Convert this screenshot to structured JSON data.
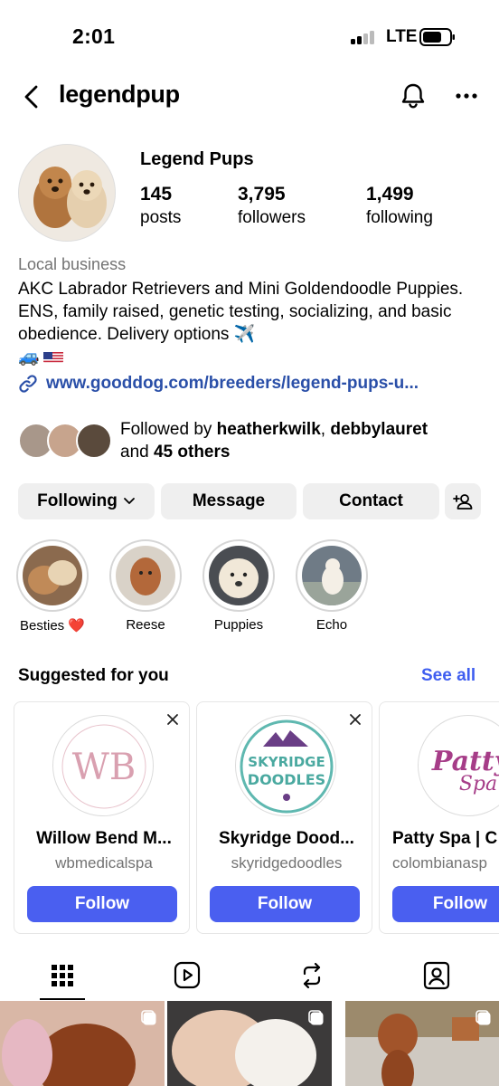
{
  "status": {
    "time": "2:01",
    "network": "LTE"
  },
  "header": {
    "username": "legendpup"
  },
  "profile": {
    "display_name": "Legend Pups",
    "stats": [
      {
        "value": "145",
        "label": "posts"
      },
      {
        "value": "3,795",
        "label": "followers"
      },
      {
        "value": "1,499",
        "label": "following"
      }
    ],
    "category": "Local business",
    "bio": "AKC Labrador Retrievers and Mini Goldendoodle Puppies. ENS, family raised, genetic testing, socializing, and basic obedience. Delivery options ✈️",
    "bio_emoji_line": "🚙",
    "link": "www.gooddog.com/breeders/legend-pups-u...",
    "followed_by": {
      "prefix": "Followed by ",
      "user1": "heatherkwilk",
      "separator": ", ",
      "user2": "debbylauret",
      "and": "and ",
      "others": "45 others"
    }
  },
  "actions": {
    "following": "Following",
    "message": "Message",
    "contact": "Contact"
  },
  "highlights": [
    {
      "label": "Besties ❤️"
    },
    {
      "label": "Reese"
    },
    {
      "label": "Puppies"
    },
    {
      "label": "Echo"
    }
  ],
  "suggested": {
    "title": "Suggested for you",
    "see_all": "See all",
    "cards": [
      {
        "name": "Willow Bend M...",
        "handle": "wbmedicalspa",
        "follow": "Follow",
        "logo_text": "WB",
        "logo_ring_text": "WILLOW BEND MEDICAL SPA"
      },
      {
        "name": "Skyridge Dood...",
        "handle": "skyridgedoodles",
        "follow": "Follow",
        "logo_text_1": "SKYRIDGE",
        "logo_text_2": "DOODLES"
      },
      {
        "name": "Patty Spa | C",
        "handle": "colombianasp",
        "follow": "Follow",
        "logo_text_1": "Patty",
        "logo_text_2": "Spa"
      }
    ]
  },
  "colors": {
    "accent_blue": "#4a5ff0",
    "link_blue": "#2a4fa8",
    "button_gray": "#efefef",
    "secondary_text": "#737373"
  },
  "icons": {
    "back": "chevron-left-icon",
    "bell": "bell-icon",
    "more": "more-horizontal-icon",
    "link": "link-icon",
    "add_person": "add-person-icon",
    "grid": "grid-icon",
    "reels": "reels-icon",
    "reposts": "repost-icon",
    "tagged": "tagged-icon"
  }
}
